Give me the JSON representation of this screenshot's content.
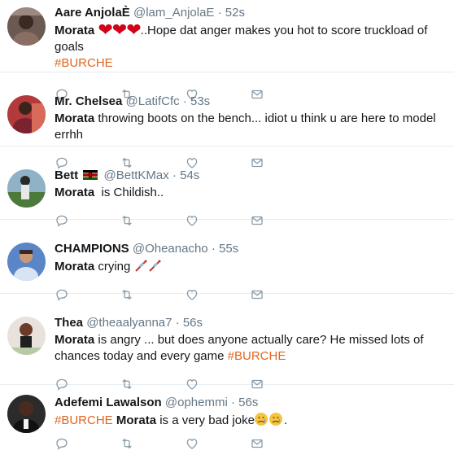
{
  "tweets": [
    {
      "name": "Aare AnjolaÈ",
      "handle": "@lam_AnjolaE",
      "time": "52s",
      "text_bold": "Morata",
      "text_after": "..Hope dat anger makes you hot to score truckload of goals",
      "hashtag_end": "#BURCHE"
    },
    {
      "name": "Mr. Chelsea",
      "handle": "@LatifCfc",
      "time": "53s",
      "text_bold": "Morata",
      "text_after": " throwing boots on the bench... idiot u think u are here to model errhh"
    },
    {
      "name": "Bett",
      "handle": "@BettKMax",
      "time": "54s",
      "text_bold": "Morata",
      "text_after": "  is Childish.."
    },
    {
      "name": "CHAMPIONS",
      "handle": "@Oheanacho",
      "time": "55s",
      "text_bold": "Morata",
      "text_after": " crying "
    },
    {
      "name": "Thea",
      "handle": "@theaalyanna7",
      "time": "56s",
      "text_bold": "Morata",
      "text_after": " is angry ... but does anyone actually care? He missed lots of chances today and every game ",
      "hashtag_end": "#BURCHE"
    },
    {
      "name": "Adefemi Lawalson",
      "handle": "@ophemmi",
      "time": "56s",
      "hashtag_start": "#BURCHE",
      "text_bold": "Morata",
      "text_after": " is a very bad joke",
      "text_end": "."
    }
  ],
  "separator": "·",
  "icons": {
    "reply": "reply-icon",
    "retweet": "retweet-icon",
    "like": "heart-icon",
    "dm": "envelope-icon"
  },
  "colors": {
    "hashtag": "#e0661e",
    "secondary": "#657786",
    "icon": "#8899a6",
    "divider": "#e6ecf0"
  }
}
